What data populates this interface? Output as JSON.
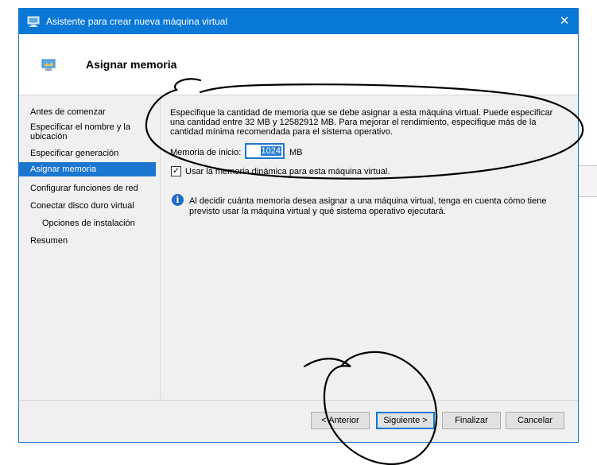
{
  "window": {
    "title": "Asistente para crear nueva máquina virtual",
    "close_symbol": "✕",
    "accent_color": "#0a78d7"
  },
  "header": {
    "title": "Asignar memoria"
  },
  "sidebar": {
    "items": [
      {
        "label": "Antes de comenzar"
      },
      {
        "label": "Especificar el nombre y la ubicación"
      },
      {
        "label": "Especificar generación"
      },
      {
        "label": "Asignar memoria"
      },
      {
        "label": "Configurar funciones de red"
      },
      {
        "label": "Conectar disco duro virtual"
      },
      {
        "label": "Opciones de instalación"
      },
      {
        "label": "Resumen"
      }
    ],
    "active_item": "Asignar memoria"
  },
  "main": {
    "description": "Especifique la cantidad de memoria que se debe asignar a esta máquina virtual. Puede especificar una cantidad entre 32 MB y 12582912 MB. Para mejorar el rendimiento, especifique más de la cantidad mínima recomendada para el sistema operativo.",
    "memory_label": "Memoria de inicio:",
    "memory_value": "1024",
    "memory_unit": "MB",
    "dynamic_memory_label": "Usar la memoria dinámica para esta máquina virtual.",
    "dynamic_memory_checked": true,
    "checkmark": "✓",
    "info_symbol": "i",
    "info_text": "Al decidir cuánta memoria desea asignar a una máquina virtual, tenga en cuenta cómo tiene previsto usar la máquina virtual y qué sistema operativo ejecutará."
  },
  "footer": {
    "previous": "< Anterior",
    "next": "Siguiente >",
    "finish": "Finalizar",
    "cancel": "Cancelar"
  }
}
